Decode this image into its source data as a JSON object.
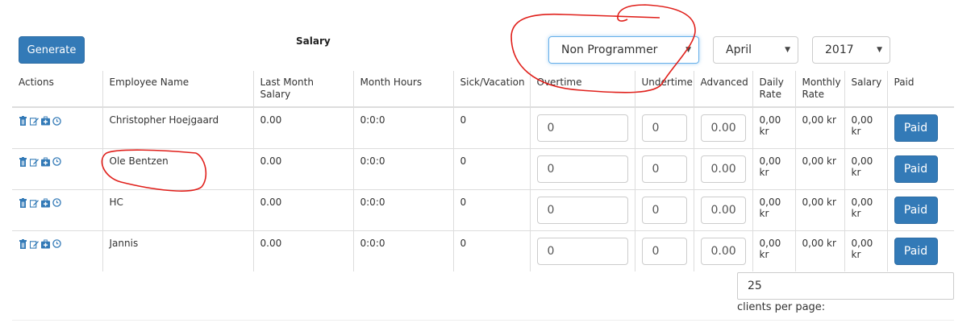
{
  "toolbar": {
    "generate_label": "Generate",
    "heading": "Salary",
    "employee_type": "Non Programmer",
    "month": "April",
    "year": "2017"
  },
  "table": {
    "headers": {
      "actions": "Actions",
      "employee_name": "Employee Name",
      "last_month_salary": "Last Month Salary",
      "month_hours": "Month Hours",
      "sick_vacation": "Sick/Vacation",
      "overtime": "Overtime",
      "undertime": "Undertime",
      "advanced": "Advanced",
      "daily_rate_1": "Daily",
      "daily_rate_2": "Rate",
      "monthly_rate_1": "Monthly",
      "monthly_rate_2": "Rate",
      "salary": "Salary",
      "paid": "Paid"
    },
    "rows": [
      {
        "name": "Christopher Hoejgaard",
        "last_month_salary": "0.00",
        "month_hours": "0:0:0",
        "sick_vacation": "0",
        "overtime": "0",
        "undertime": "0",
        "advanced": "0.00",
        "daily_rate": "0,00 kr",
        "monthly_rate": "0,00 kr",
        "salary": "0,00 kr",
        "paid_label": "Paid"
      },
      {
        "name": "Ole Bentzen",
        "last_month_salary": "0.00",
        "month_hours": "0:0:0",
        "sick_vacation": "0",
        "overtime": "0",
        "undertime": "0",
        "advanced": "0.00",
        "daily_rate": "0,00 kr",
        "monthly_rate": "0,00 kr",
        "salary": "0,00 kr",
        "paid_label": "Paid"
      },
      {
        "name": "HC",
        "last_month_salary": "0.00",
        "month_hours": "0:0:0",
        "sick_vacation": "0",
        "overtime": "0",
        "undertime": "0",
        "advanced": "0.00",
        "daily_rate": "0,00 kr",
        "monthly_rate": "0,00 kr",
        "salary": "0,00 kr",
        "paid_label": "Paid"
      },
      {
        "name": "Jannis",
        "last_month_salary": "0.00",
        "month_hours": "0:0:0",
        "sick_vacation": "0",
        "overtime": "0",
        "undertime": "0",
        "advanced": "0.00",
        "daily_rate": "0,00 kr",
        "monthly_rate": "0,00 kr",
        "salary": "0,00 kr",
        "paid_label": "Paid"
      }
    ]
  },
  "pagination": {
    "per_page_value": "25",
    "per_page_label": "clients per page:"
  },
  "icons": {
    "row_actions": [
      "trash-icon",
      "edit-icon",
      "medical-kit-icon",
      "clock-icon"
    ],
    "select_caret": "caret-down-icon"
  },
  "colors": {
    "primary": "#337ab7",
    "icon": "#337ab7",
    "annotation": "#e0201b",
    "border": "#dddddd"
  }
}
